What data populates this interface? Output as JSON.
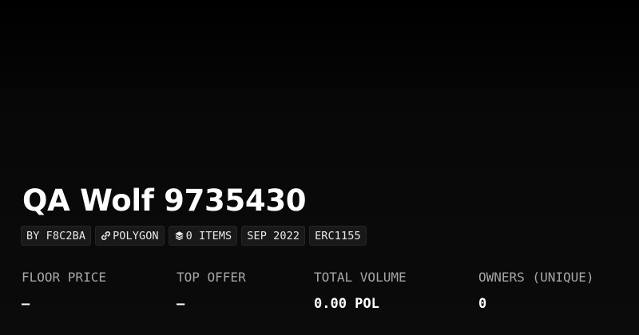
{
  "collection": {
    "title": "QA Wolf 9735430"
  },
  "chips": {
    "creator": "BY F8C2BA",
    "chain": "POLYGON",
    "chain_icon": "link-icon",
    "items": "0 ITEMS",
    "items_icon": "layers-icon",
    "date": "SEP 2022",
    "standard": "ERC1155"
  },
  "stats": {
    "floor_price": {
      "label": "FLOOR PRICE",
      "value": "—"
    },
    "top_offer": {
      "label": "TOP OFFER",
      "value": "—"
    },
    "total_volume": {
      "label": "TOTAL VOLUME",
      "value": "0.00 POL"
    },
    "owners": {
      "label": "OWNERS (UNIQUE)",
      "value": "0"
    }
  }
}
